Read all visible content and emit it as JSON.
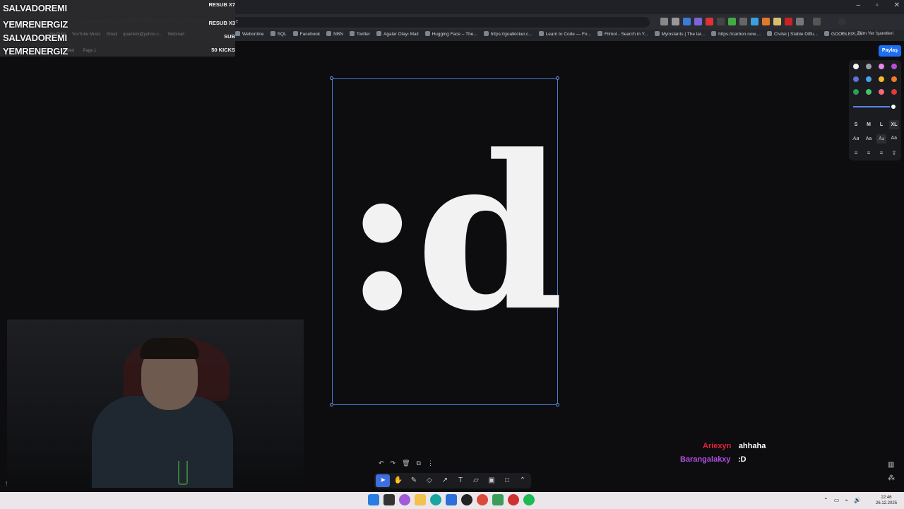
{
  "browser": {
    "url": "tldraw.com/f/yzgp7QsROc3FUT7oGMtz?d=v1179.4004.4500.4000.page",
    "window_controls": [
      "–",
      "▫",
      "✕"
    ],
    "bookmarks": [
      "Webonline",
      "SQL",
      "Facebook",
      "NBN",
      "Twitter",
      "Agalar Olayı Mail",
      "Hugging Face – The...",
      "https://goalkicker.c...",
      "Learn to Code — Fo...",
      "Filmot - Search in Y...",
      "Myinstants | The lar...",
      "https://carbon.now....",
      "Civitai | Stable Diffu...",
      "GOOGLEPLAY"
    ],
    "bookmarks_more": "»",
    "other_bookmarks": "Tüm Yer İşaretleri"
  },
  "overlay": {
    "alerts": [
      {
        "name": "SALVADOREMI",
        "tag": "RESUB X7"
      },
      {
        "name": "YEMRENERGIZ",
        "tag": "RESUB X3"
      },
      {
        "name": "SALVADOREMI",
        "tag": "SUB"
      },
      {
        "name": "YEMRENERGIZ",
        "tag": "50 KICKS"
      }
    ],
    "ghost_bookmarks": [
      "YouTube",
      "YouTube Music",
      "Gmail",
      "quantem@yahoo.c...",
      "Webmail"
    ],
    "ghost_page": [
      "Untitled",
      "Page 1"
    ]
  },
  "canvas": {
    "share_label": "Paylaş",
    "frame_text": ":d"
  },
  "style_panel": {
    "colors": [
      "#f2f2f2",
      "#9aa0a6",
      "#e38ae8",
      "#b44fd6",
      "#5e6fe0",
      "#4a9ff0",
      "#f5b92e",
      "#f07a2a",
      "#2aa05a",
      "#43c46b",
      "#f06a7a",
      "#e03a3a"
    ],
    "opacity": 1.0,
    "sizes": [
      "S",
      "M",
      "L",
      "XL"
    ],
    "selected_size": "XL",
    "fonts": [
      "Aa",
      "Aa",
      "Aa",
      "Aa"
    ],
    "selected_font": 2,
    "align": [
      "≡",
      "≡",
      "≡",
      "⇳"
    ]
  },
  "chat": [
    {
      "user": "Ariexyn",
      "color": "#e0243a",
      "message": "ahhaha"
    },
    {
      "user": "Barangalakxy",
      "color": "#b04fe0",
      "message": ":D"
    }
  ],
  "toolbar": {
    "actions": [
      "↶",
      "↷",
      "🗑",
      "⧉",
      "⋮"
    ],
    "tools": [
      {
        "icon": "select-icon",
        "glyph": "➤",
        "active": true
      },
      {
        "icon": "hand-icon",
        "glyph": "✋",
        "active": false
      },
      {
        "icon": "pencil-icon",
        "glyph": "✎",
        "active": false
      },
      {
        "icon": "eraser-icon",
        "glyph": "◇",
        "active": false
      },
      {
        "icon": "arrow-icon",
        "glyph": "↗",
        "active": false
      },
      {
        "icon": "text-icon",
        "glyph": "T",
        "active": false
      },
      {
        "icon": "note-icon",
        "glyph": "▱",
        "active": false
      },
      {
        "icon": "image-icon",
        "glyph": "▣",
        "active": false
      },
      {
        "icon": "rectangle-icon",
        "glyph": "□",
        "active": false
      },
      {
        "icon": "chevron-up-icon",
        "glyph": "⌃",
        "active": false
      }
    ]
  },
  "taskbar": {
    "clock_time": "22:46",
    "clock_date": "26.12.2025",
    "tray": [
      "⌃",
      "▭",
      "⌁",
      "🔊"
    ]
  }
}
